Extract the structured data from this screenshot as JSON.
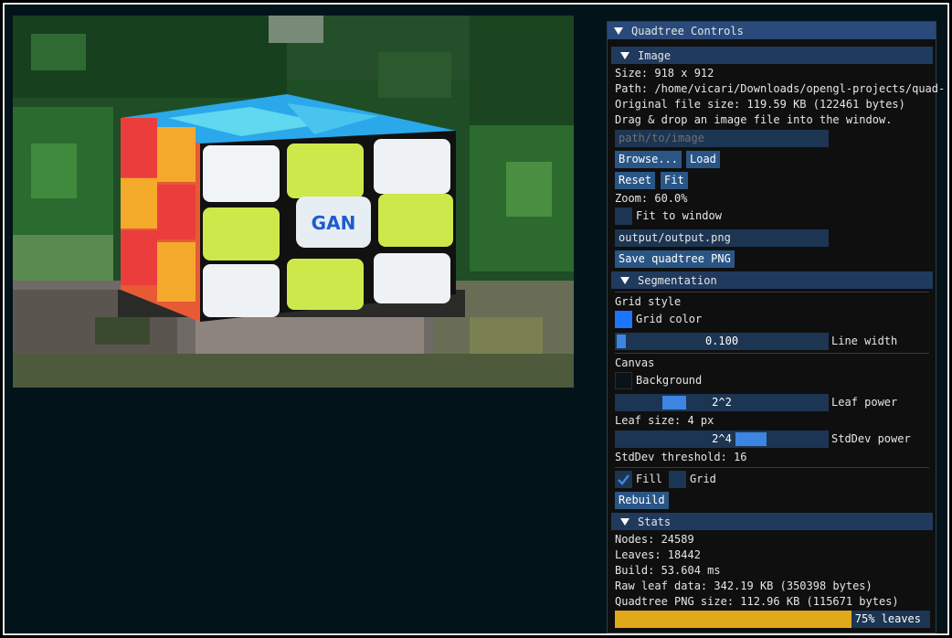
{
  "panel": {
    "title": "Quadtree Controls",
    "image_section": {
      "header": "Image",
      "size": "Size: 918 x 912",
      "path": "Path: /home/vicari/Downloads/opengl-projects/quad-",
      "original_size": "Original file size: 119.59 KB (122461 bytes)",
      "hint": "Drag & drop an image file into the window.",
      "path_input_placeholder": "path/to/image",
      "browse_label": "Browse...",
      "load_label": "Load",
      "reset_label": "Reset",
      "fit_label": "Fit",
      "zoom": "Zoom: 60.0%",
      "fit_to_window_label": "Fit to window",
      "fit_to_window_checked": false,
      "output_path": "output/output.png",
      "save_label": "Save quadtree PNG"
    },
    "segmentation": {
      "header": "Segmentation",
      "grid_style_label": "Grid style",
      "grid_color_label": "Grid color",
      "grid_color": "#1f74ff",
      "line_width_value": "0.100",
      "line_width_fraction": 0.1,
      "line_width_label": "Line width",
      "canvas_label": "Canvas",
      "background_label": "Background",
      "background_color": "#0a1418",
      "leaf_power_value": "2^2",
      "leaf_power_label": "Leaf power",
      "leaf_size": "Leaf size: 4 px",
      "stddev_power_value": "2^4",
      "stddev_power_label": "StdDev power",
      "stddev_threshold": "StdDev threshold: 16",
      "fill_label": "Fill",
      "fill_checked": true,
      "grid_label": "Grid",
      "grid_checked": false,
      "rebuild_label": "Rebuild"
    },
    "stats": {
      "header": "Stats",
      "nodes": "Nodes:  24589",
      "leaves": "Leaves: 18442",
      "build": "Build:  53.604 ms",
      "raw_leaf": "Raw leaf data: 342.19 KB (350398 bytes)",
      "png_size": "Quadtree PNG size: 112.96 KB (115671 bytes)",
      "leaves_fraction": 0.75,
      "leaves_progress_label": "75% leaves"
    }
  },
  "viewport": {
    "cube_logo": "GAN"
  },
  "colors": {
    "accent": "#3d85e0",
    "header": "#294a7a",
    "section": "#203a5e",
    "progress": "#e2a81c"
  }
}
